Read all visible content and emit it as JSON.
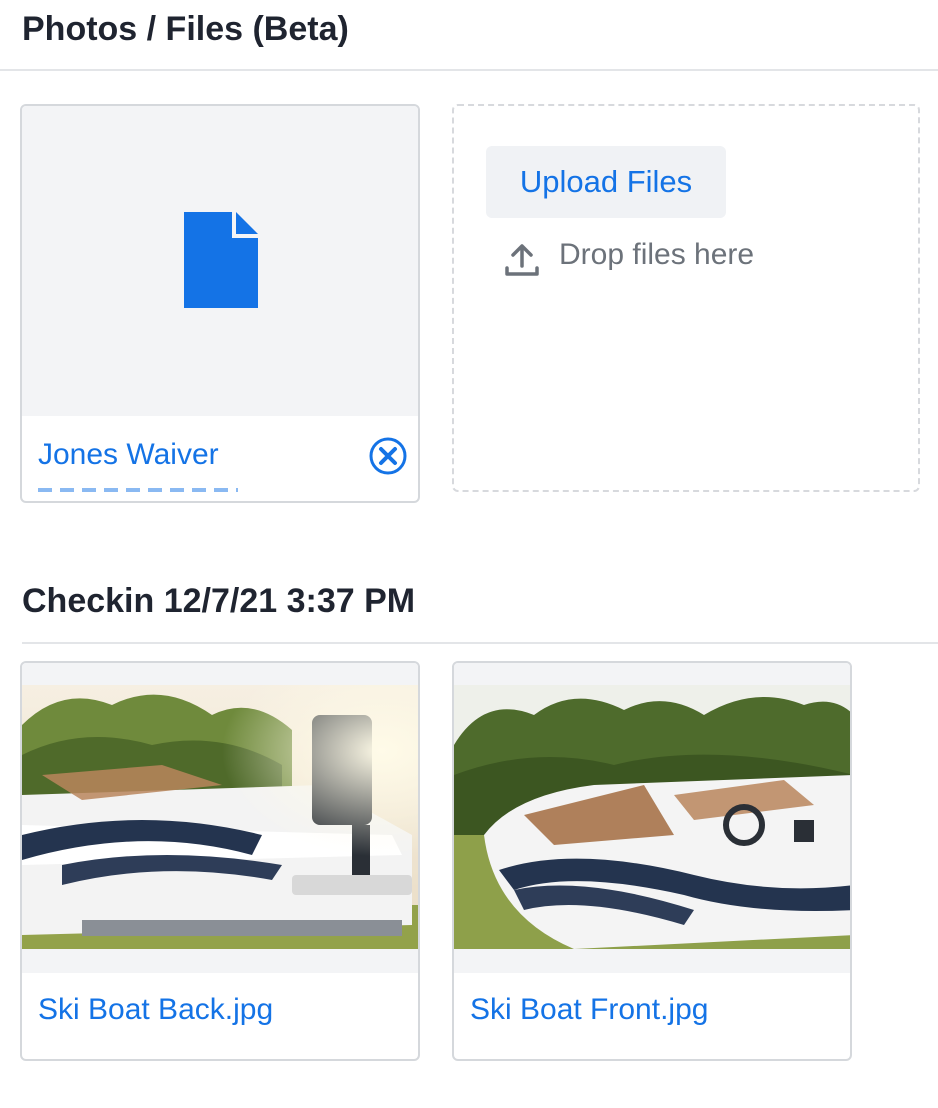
{
  "section_header": {
    "title": "Photos / Files (Beta)"
  },
  "file_card": {
    "name": "Jones Waiver",
    "icon": "document-icon",
    "remove_icon": "close-circle-icon",
    "accent": "#1473e6"
  },
  "upload": {
    "button_label": "Upload Files",
    "drop_text": "Drop files here",
    "icon": "upload-icon"
  },
  "checkin": {
    "title": "Checkin 12/7/21 3:37 PM",
    "photos": [
      {
        "name": "Ski Boat Back.jpg"
      },
      {
        "name": "Ski Boat Front.jpg"
      }
    ]
  }
}
